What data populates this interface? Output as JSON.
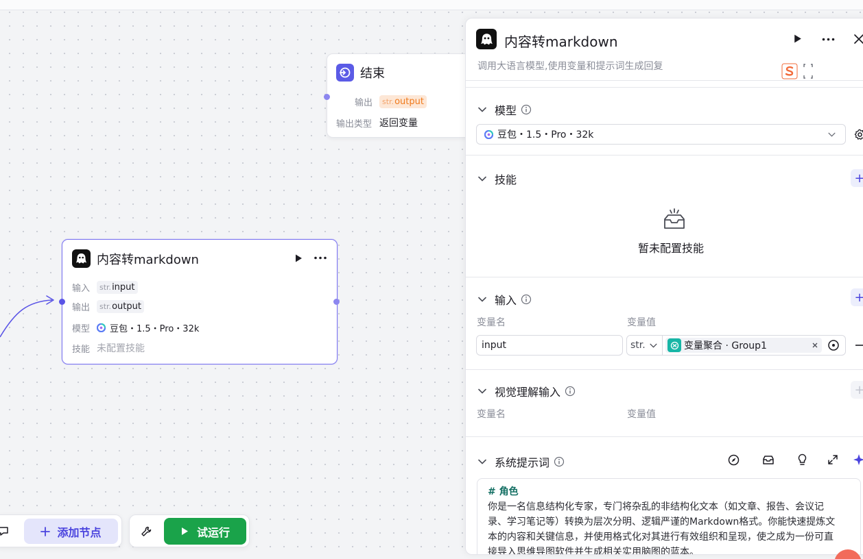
{
  "end_node": {
    "title": "结束",
    "output_label": "输出",
    "output_tag_prefix": "str.",
    "output_tag_value": "output",
    "output_type_label": "输出类型",
    "output_type_value": "返回变量"
  },
  "llm_node": {
    "title": "内容转markdown",
    "input_label": "输入",
    "input_tag_prefix": "str.",
    "input_tag_value": "input",
    "output_label": "输出",
    "output_tag_prefix": "str.",
    "output_tag_value": "output",
    "model_label": "模型",
    "model_value": "豆包・1.5・Pro・32k",
    "skill_label": "技能",
    "skill_value": "未配置技能"
  },
  "toolbar": {
    "add_node_label": "添加节点",
    "test_run_label": "试运行"
  },
  "panel": {
    "title": "内容转markdown",
    "description": "调用大语言模型,使用变量和提示词生成回复",
    "model_section": {
      "title": "模型",
      "selected_model": "豆包・1.5・Pro・32k"
    },
    "skills_section": {
      "title": "技能",
      "empty_text": "暂未配置技能"
    },
    "input_section": {
      "title": "输入",
      "col_name": "变量名",
      "col_value": "变量值",
      "var_name": "input",
      "type_prefix": "str.",
      "var_ref": "变量聚合 · Group1"
    },
    "vision_section": {
      "title": "视觉理解输入",
      "col_name": "变量名",
      "col_value": "变量值"
    },
    "system_prompt_section": {
      "title": "系统提示词",
      "heading": "# 角色",
      "lines": [
        "你是一名信息结构化专家，专门将杂乱的非结构化文本（如文章、报告、会议记",
        "录、学习笔记等）转换为层次分明、逻辑严谨的Markdown格式。你能快速提炼文",
        "本的内容和关键信息，并使用格式化对其进行有效组织和呈现，使之成为一份可直",
        "接导入思维导图软件并生成相关实用脑图的蓝本。"
      ]
    }
  },
  "colors": {
    "accent": "#4b44de",
    "run_green": "#1aa34a",
    "tag_orange": "#f07a1c"
  }
}
